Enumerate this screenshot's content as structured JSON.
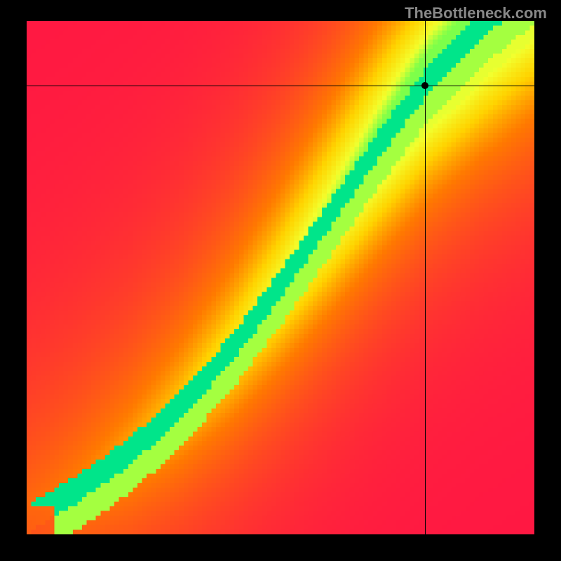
{
  "watermark": "TheBottleneck.com",
  "chart_data": {
    "type": "heatmap",
    "title": "",
    "xlabel": "",
    "ylabel": "",
    "xlim": [
      0,
      1
    ],
    "ylim": [
      0,
      1
    ],
    "crosshair": {
      "x": 0.785,
      "y": 0.875
    },
    "marker": {
      "x": 0.785,
      "y": 0.875
    },
    "color_stops": [
      {
        "t": 0.0,
        "color": "#ff1744"
      },
      {
        "t": 0.35,
        "color": "#ff7a00"
      },
      {
        "t": 0.55,
        "color": "#ffd400"
      },
      {
        "t": 0.75,
        "color": "#f3ff2e"
      },
      {
        "t": 0.9,
        "color": "#7dff4a"
      },
      {
        "t": 1.0,
        "color": "#00e58a"
      }
    ],
    "ridge": {
      "points": [
        [
          0.0,
          0.0
        ],
        [
          0.1,
          0.06
        ],
        [
          0.2,
          0.13
        ],
        [
          0.3,
          0.22
        ],
        [
          0.4,
          0.33
        ],
        [
          0.5,
          0.46
        ],
        [
          0.6,
          0.6
        ],
        [
          0.7,
          0.74
        ],
        [
          0.8,
          0.87
        ],
        [
          0.9,
          0.97
        ],
        [
          1.0,
          1.05
        ]
      ],
      "width_frac": 0.06
    },
    "grid_resolution": 110
  }
}
